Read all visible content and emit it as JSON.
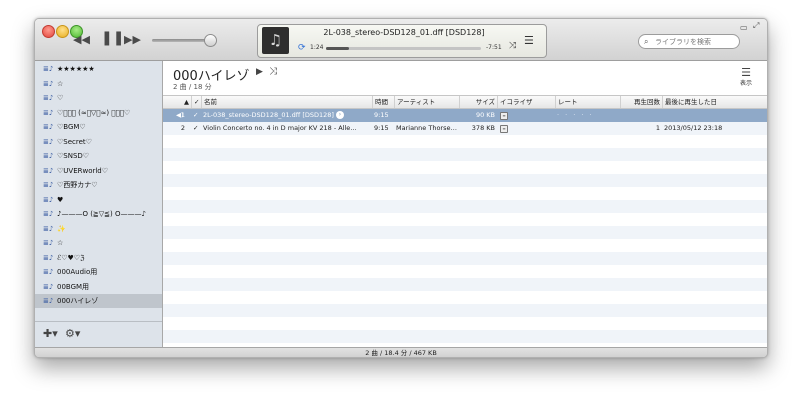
{
  "now_playing": {
    "title": "2L-038_stereo-DSD128_01.dff [DSD128]",
    "elapsed": "1:24",
    "remaining": "-7:51",
    "progress": 0.15
  },
  "search": {
    "placeholder": "ライブラリを検索"
  },
  "sidebar": {
    "items": [
      {
        "label": "★★★★★★"
      },
      {
        "label": "☆"
      },
      {
        "label": "♡"
      },
      {
        "label": "♡ﾟ･｡ (≈ﾟ▽ﾟ≈) ･｡ﾟ♡"
      },
      {
        "label": "♡BGM♡"
      },
      {
        "label": "♡Secret♡"
      },
      {
        "label": "♡SNSD♡"
      },
      {
        "label": "♡UVERworld♡"
      },
      {
        "label": "♡西野カナ♡"
      },
      {
        "label": "♥"
      },
      {
        "label": "♪———O (≧▽≦) O———♪"
      },
      {
        "label": "✨"
      },
      {
        "label": "☆"
      },
      {
        "label": "ℰ♡♥♡ℨ"
      },
      {
        "label": "000Audio用"
      },
      {
        "label": "00BGM用"
      },
      {
        "label": "000ハイレゾ"
      }
    ],
    "selected_index": 16
  },
  "playlist": {
    "title": "000ハイレゾ",
    "summary": "2 曲 / 18 分",
    "view_label": "表示"
  },
  "columns": {
    "name": "名前",
    "time": "時間",
    "artist": "アーティスト",
    "size": "サイズ",
    "equalizer": "イコライザ",
    "rating": "レート",
    "plays": "再生回数",
    "last_played": "最後に再生した日"
  },
  "tracks": [
    {
      "num": "1",
      "check": "✓",
      "name": "2L-038_stereo-DSD128_01.dff [DSD128]",
      "time": "9:15",
      "artist": "",
      "size": "90 KB",
      "rating": "· · · · ·",
      "plays": "",
      "last_played": ""
    },
    {
      "num": "2",
      "check": "✓",
      "name": "Violin Concerto no. 4 in D major KV 218 - Alle…",
      "time": "9:15",
      "artist": "Marianne Thorse…",
      "size": "378 KB",
      "rating": "",
      "plays": "1",
      "last_played": "2013/05/12 23:18"
    }
  ],
  "status": {
    "text": "2 曲 / 18.4 分 / 467 KB"
  },
  "colors": {
    "selection": "#8fa9c8",
    "sidebar": "#dde3ea",
    "accent": "#2f6fd6"
  }
}
